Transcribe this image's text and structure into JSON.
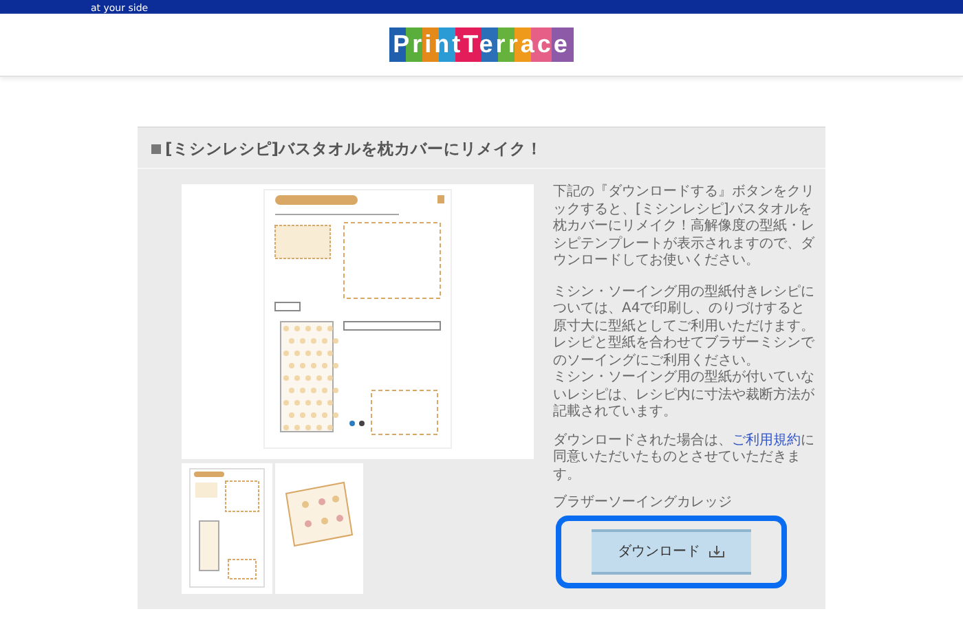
{
  "header": {
    "tagline": "at your side",
    "logo": "PrintTerrace"
  },
  "section": {
    "title": "[ミシンレシピ]バスタオルを枕カバーにリメイク！"
  },
  "description": [
    "下記の『ダウンロードする』ボタンをクリックすると、[ミシンレシピ]バスタオルを枕カバーにリメイク！高解像度の型紙・レシピテンプレートが表示されますので、ダウンロードしてお使いください。",
    "ミシン・ソーイング用の型紙付きレシピについては、A4で印刷し、のりづけすると原寸大に型紙としてご利用いただけます。レシピと型紙を合わせてブラザーミシンでのソーイングにご利用ください。",
    "ミシン・ソーイング用の型紙が付いていないレシピは、レシピ内に寸法や裁断方法が記載されています。"
  ],
  "note": {
    "before": "ダウンロードされた場合は、",
    "link": "ご利用規約",
    "after": "に同意いただいたものとさせていただきます。"
  },
  "brand": "ブラザーソーイングカレッジ",
  "download_button": {
    "label": "ダウンロード"
  }
}
